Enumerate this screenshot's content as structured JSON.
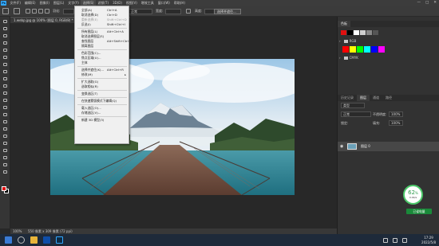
{
  "app": {
    "logo": "Ps",
    "menus": [
      "文件(F)",
      "编辑(E)",
      "图像(I)",
      "图层(L)",
      "文字(Y)",
      "选择(S)",
      "滤镜(T)",
      "3D(D)",
      "视图(V)",
      "增效工具",
      "窗口(W)",
      "帮助(H)"
    ],
    "active_menu_index": 5,
    "window_controls": [
      "—",
      "□",
      "✕"
    ]
  },
  "options_bar": {
    "feather_label": "羽化:",
    "feather_value": "0 像素",
    "antialias_label": "消除锯齿",
    "style_label": "样式:",
    "style_value": "正常",
    "width_label": "宽度:",
    "height_label": "高度:",
    "select_mask_button": "选择并遮住..."
  },
  "document": {
    "tab_title": "1.webp.jpg @ 100% (图层 0, RGB/8) *",
    "status_zoom": "100%",
    "status_info": "550 像素 x 309 像素 (72 ppi)"
  },
  "select_menu": {
    "items": [
      {
        "label": "全部(A)",
        "shortcut": "Ctrl+A",
        "disabled": false,
        "submenu": false
      },
      {
        "label": "取消选择(D)",
        "shortcut": "Ctrl+D",
        "disabled": false,
        "submenu": false
      },
      {
        "label": "重新选择(E)",
        "shortcut": "Shift+Ctrl+D",
        "disabled": true,
        "submenu": false
      },
      {
        "label": "反选(I)",
        "shortcut": "Shift+Ctrl+I",
        "disabled": false,
        "submenu": false
      },
      {
        "sep": true
      },
      {
        "label": "所有图层(L)",
        "shortcut": "Alt+Ctrl+A",
        "disabled": false,
        "submenu": false
      },
      {
        "label": "取消选择图层(S)",
        "shortcut": "",
        "disabled": false,
        "submenu": false
      },
      {
        "label": "查找图层",
        "shortcut": "Alt+Shift+Ctrl+F",
        "disabled": false,
        "submenu": false
      },
      {
        "label": "隔离图层",
        "shortcut": "",
        "disabled": false,
        "submenu": false
      },
      {
        "sep": true
      },
      {
        "label": "色彩范围(C)...",
        "shortcut": "",
        "disabled": false,
        "submenu": false
      },
      {
        "label": "焦点区域(U)...",
        "shortcut": "",
        "disabled": false,
        "submenu": false
      },
      {
        "label": "主体",
        "shortcut": "",
        "disabled": false,
        "submenu": false
      },
      {
        "sep": true
      },
      {
        "label": "选择并遮住(K)...",
        "shortcut": "Alt+Ctrl+R",
        "disabled": false,
        "submenu": false
      },
      {
        "label": "修改(M)",
        "shortcut": "",
        "disabled": false,
        "submenu": true
      },
      {
        "sep": true
      },
      {
        "label": "扩大选取(G)",
        "shortcut": "",
        "disabled": false,
        "submenu": false
      },
      {
        "label": "选取相似(R)",
        "shortcut": "",
        "disabled": false,
        "submenu": false
      },
      {
        "sep": true
      },
      {
        "label": "变换选区(T)",
        "shortcut": "",
        "disabled": false,
        "submenu": false
      },
      {
        "sep": true
      },
      {
        "label": "在快速蒙版模式下编辑(Q)",
        "shortcut": "",
        "disabled": false,
        "submenu": false
      },
      {
        "sep": true
      },
      {
        "label": "载入选区(O)...",
        "shortcut": "",
        "disabled": false,
        "submenu": false
      },
      {
        "label": "存储选区(V)...",
        "shortcut": "",
        "disabled": false,
        "submenu": false
      },
      {
        "sep": true
      },
      {
        "label": "新建 3D 模型(3)",
        "shortcut": "",
        "disabled": false,
        "submenu": false
      }
    ]
  },
  "swatches_panel": {
    "tab_label": "色板",
    "swatch_colors": [
      "#e01010",
      "#000000",
      "#ffffff",
      "#d0d0d0",
      "#888888",
      "#555555"
    ],
    "groups": [
      {
        "name": "RGB",
        "colors": [
          "#ff0000",
          "#ffff00",
          "#00ff00",
          "#00ffff",
          "#0000ff",
          "#ff00ff"
        ]
      },
      {
        "name": "CMYK",
        "colors": []
      }
    ]
  },
  "layers_panel": {
    "tabs": [
      "历史记录",
      "图层",
      "通道",
      "路径"
    ],
    "active_tab_index": 1,
    "kind_label": "类型",
    "blend_mode": "正常",
    "opacity_label": "不透明度:",
    "opacity_value": "100%",
    "lock_label": "锁定:",
    "fill_label": "填充:",
    "fill_value": "100%",
    "layers": [
      {
        "name": "图层 0",
        "visible": true
      }
    ]
  },
  "net_widget": {
    "percent": "62",
    "unit": "%",
    "speed": "0.4K/s"
  },
  "green_badge": "已省电量",
  "taskbar": {
    "time": "17:29",
    "date": "2022/5/8"
  }
}
